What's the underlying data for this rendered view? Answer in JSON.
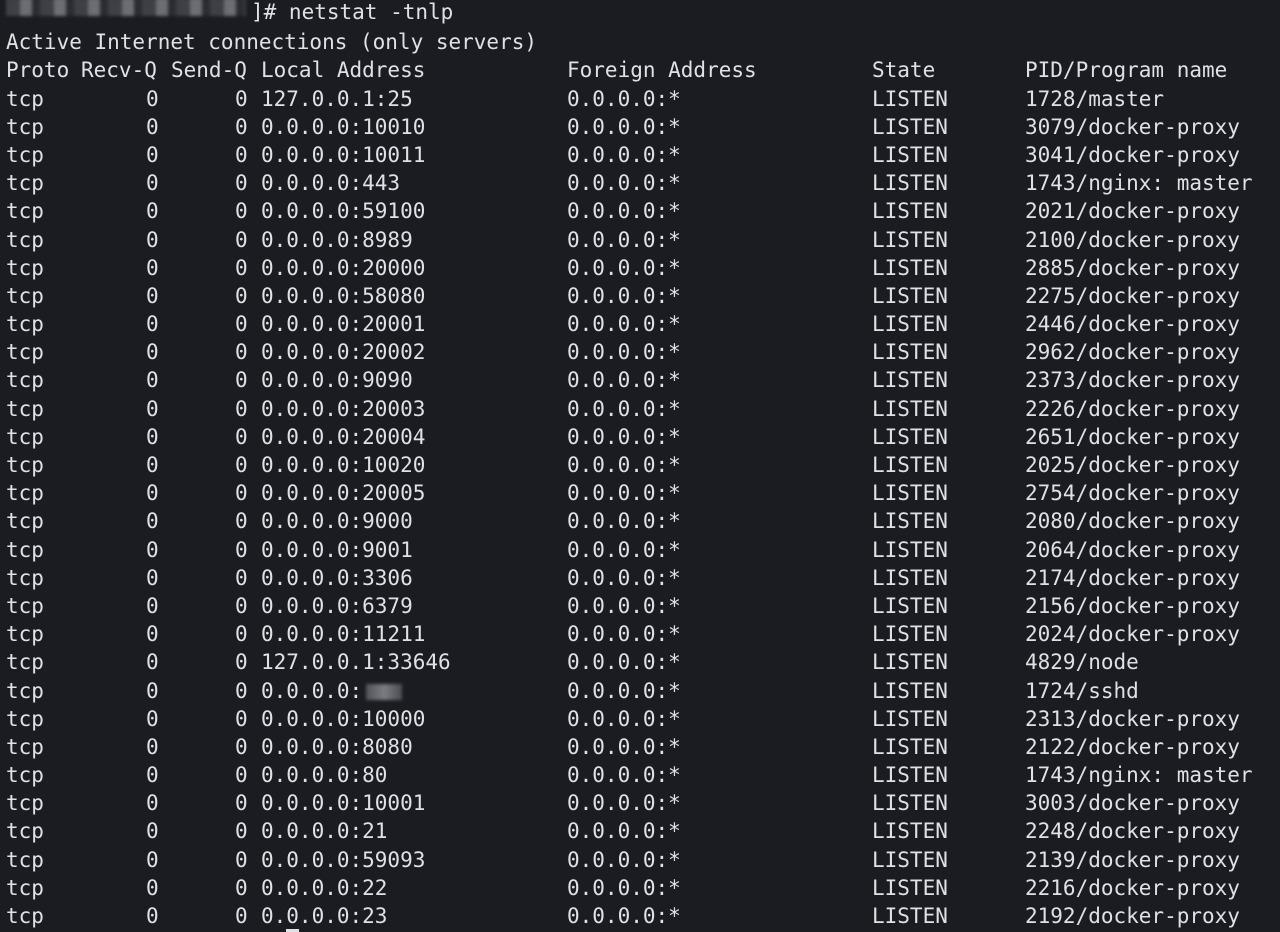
{
  "prompt": {
    "command": "]# netstat -tnlp"
  },
  "heading": "Active Internet connections (only servers)",
  "columns": {
    "proto": "Proto",
    "recv": "Recv-Q",
    "send": "Send-Q",
    "local": "Local Address",
    "foreign": "Foreign Address",
    "state": "State",
    "pid": "PID/Program name"
  },
  "rows": [
    {
      "proto": "tcp",
      "recv": "0",
      "send": "0",
      "local": "127.0.0.1:25",
      "foreign": "0.0.0.0:*",
      "state": "LISTEN",
      "pid": "1728/master"
    },
    {
      "proto": "tcp",
      "recv": "0",
      "send": "0",
      "local": "0.0.0.0:10010",
      "foreign": "0.0.0.0:*",
      "state": "LISTEN",
      "pid": "3079/docker-proxy"
    },
    {
      "proto": "tcp",
      "recv": "0",
      "send": "0",
      "local": "0.0.0.0:10011",
      "foreign": "0.0.0.0:*",
      "state": "LISTEN",
      "pid": "3041/docker-proxy"
    },
    {
      "proto": "tcp",
      "recv": "0",
      "send": "0",
      "local": "0.0.0.0:443",
      "foreign": "0.0.0.0:*",
      "state": "LISTEN",
      "pid": "1743/nginx: master"
    },
    {
      "proto": "tcp",
      "recv": "0",
      "send": "0",
      "local": "0.0.0.0:59100",
      "foreign": "0.0.0.0:*",
      "state": "LISTEN",
      "pid": "2021/docker-proxy"
    },
    {
      "proto": "tcp",
      "recv": "0",
      "send": "0",
      "local": "0.0.0.0:8989",
      "foreign": "0.0.0.0:*",
      "state": "LISTEN",
      "pid": "2100/docker-proxy"
    },
    {
      "proto": "tcp",
      "recv": "0",
      "send": "0",
      "local": "0.0.0.0:20000",
      "foreign": "0.0.0.0:*",
      "state": "LISTEN",
      "pid": "2885/docker-proxy"
    },
    {
      "proto": "tcp",
      "recv": "0",
      "send": "0",
      "local": "0.0.0.0:58080",
      "foreign": "0.0.0.0:*",
      "state": "LISTEN",
      "pid": "2275/docker-proxy"
    },
    {
      "proto": "tcp",
      "recv": "0",
      "send": "0",
      "local": "0.0.0.0:20001",
      "foreign": "0.0.0.0:*",
      "state": "LISTEN",
      "pid": "2446/docker-proxy"
    },
    {
      "proto": "tcp",
      "recv": "0",
      "send": "0",
      "local": "0.0.0.0:20002",
      "foreign": "0.0.0.0:*",
      "state": "LISTEN",
      "pid": "2962/docker-proxy"
    },
    {
      "proto": "tcp",
      "recv": "0",
      "send": "0",
      "local": "0.0.0.0:9090",
      "foreign": "0.0.0.0:*",
      "state": "LISTEN",
      "pid": "2373/docker-proxy"
    },
    {
      "proto": "tcp",
      "recv": "0",
      "send": "0",
      "local": "0.0.0.0:20003",
      "foreign": "0.0.0.0:*",
      "state": "LISTEN",
      "pid": "2226/docker-proxy"
    },
    {
      "proto": "tcp",
      "recv": "0",
      "send": "0",
      "local": "0.0.0.0:20004",
      "foreign": "0.0.0.0:*",
      "state": "LISTEN",
      "pid": "2651/docker-proxy"
    },
    {
      "proto": "tcp",
      "recv": "0",
      "send": "0",
      "local": "0.0.0.0:10020",
      "foreign": "0.0.0.0:*",
      "state": "LISTEN",
      "pid": "2025/docker-proxy"
    },
    {
      "proto": "tcp",
      "recv": "0",
      "send": "0",
      "local": "0.0.0.0:20005",
      "foreign": "0.0.0.0:*",
      "state": "LISTEN",
      "pid": "2754/docker-proxy"
    },
    {
      "proto": "tcp",
      "recv": "0",
      "send": "0",
      "local": "0.0.0.0:9000",
      "foreign": "0.0.0.0:*",
      "state": "LISTEN",
      "pid": "2080/docker-proxy"
    },
    {
      "proto": "tcp",
      "recv": "0",
      "send": "0",
      "local": "0.0.0.0:9001",
      "foreign": "0.0.0.0:*",
      "state": "LISTEN",
      "pid": "2064/docker-proxy"
    },
    {
      "proto": "tcp",
      "recv": "0",
      "send": "0",
      "local": "0.0.0.0:3306",
      "foreign": "0.0.0.0:*",
      "state": "LISTEN",
      "pid": "2174/docker-proxy"
    },
    {
      "proto": "tcp",
      "recv": "0",
      "send": "0",
      "local": "0.0.0.0:6379",
      "foreign": "0.0.0.0:*",
      "state": "LISTEN",
      "pid": "2156/docker-proxy"
    },
    {
      "proto": "tcp",
      "recv": "0",
      "send": "0",
      "local": "0.0.0.0:11211",
      "foreign": "0.0.0.0:*",
      "state": "LISTEN",
      "pid": "2024/docker-proxy"
    },
    {
      "proto": "tcp",
      "recv": "0",
      "send": "0",
      "local": "127.0.0.1:33646",
      "foreign": "0.0.0.0:*",
      "state": "LISTEN",
      "pid": "4829/node"
    },
    {
      "proto": "tcp",
      "recv": "0",
      "send": "0",
      "local": "0.0.0.0:",
      "foreign": "0.0.0.0:*",
      "state": "LISTEN",
      "pid": "1724/sshd",
      "redacted": true
    },
    {
      "proto": "tcp",
      "recv": "0",
      "send": "0",
      "local": "0.0.0.0:10000",
      "foreign": "0.0.0.0:*",
      "state": "LISTEN",
      "pid": "2313/docker-proxy"
    },
    {
      "proto": "tcp",
      "recv": "0",
      "send": "0",
      "local": "0.0.0.0:8080",
      "foreign": "0.0.0.0:*",
      "state": "LISTEN",
      "pid": "2122/docker-proxy"
    },
    {
      "proto": "tcp",
      "recv": "0",
      "send": "0",
      "local": "0.0.0.0:80",
      "foreign": "0.0.0.0:*",
      "state": "LISTEN",
      "pid": "1743/nginx: master"
    },
    {
      "proto": "tcp",
      "recv": "0",
      "send": "0",
      "local": "0.0.0.0:10001",
      "foreign": "0.0.0.0:*",
      "state": "LISTEN",
      "pid": "3003/docker-proxy"
    },
    {
      "proto": "tcp",
      "recv": "0",
      "send": "0",
      "local": "0.0.0.0:21",
      "foreign": "0.0.0.0:*",
      "state": "LISTEN",
      "pid": "2248/docker-proxy"
    },
    {
      "proto": "tcp",
      "recv": "0",
      "send": "0",
      "local": "0.0.0.0:59093",
      "foreign": "0.0.0.0:*",
      "state": "LISTEN",
      "pid": "2139/docker-proxy"
    },
    {
      "proto": "tcp",
      "recv": "0",
      "send": "0",
      "local": "0.0.0.0:22",
      "foreign": "0.0.0.0:*",
      "state": "LISTEN",
      "pid": "2216/docker-proxy"
    },
    {
      "proto": "tcp",
      "recv": "0",
      "send": "0",
      "local": "0.0.0.0:23",
      "foreign": "0.0.0.0:*",
      "state": "LISTEN",
      "pid": "2192/docker-proxy"
    }
  ]
}
